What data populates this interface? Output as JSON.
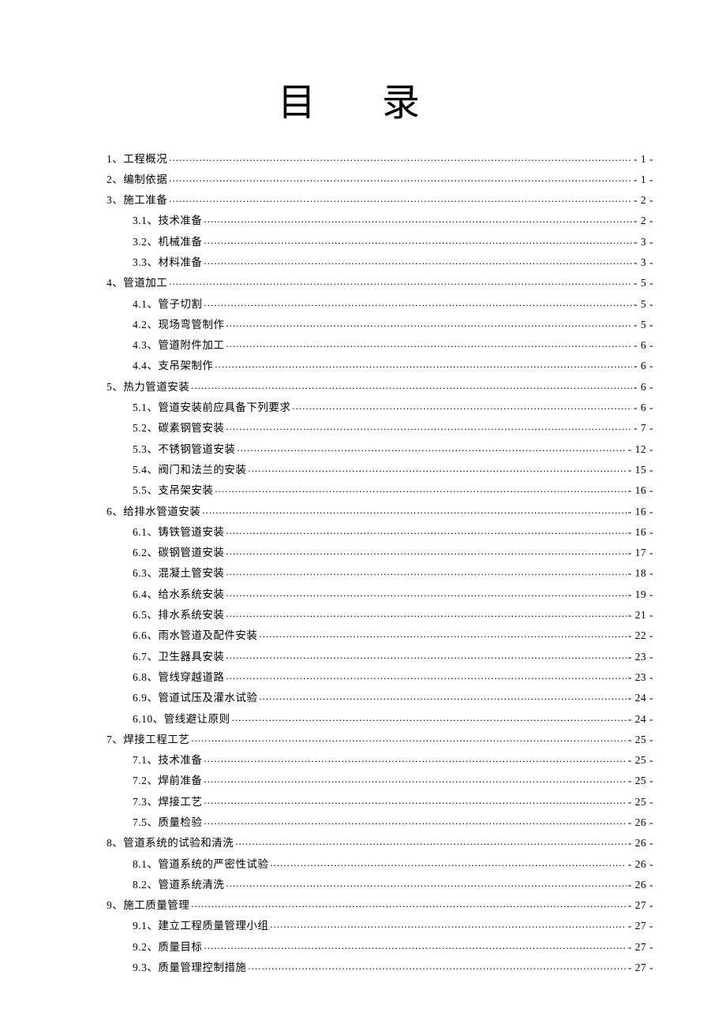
{
  "title": "目  录",
  "toc": [
    {
      "level": 1,
      "label": "1、工程概况",
      "page": "- 1 -"
    },
    {
      "level": 1,
      "label": "2、编制依据",
      "page": "- 1 -"
    },
    {
      "level": 1,
      "label": "3、施工准备",
      "page": "- 2 -"
    },
    {
      "level": 2,
      "label": "3.1、技术准备",
      "page": "- 2 -"
    },
    {
      "level": 2,
      "label": "3.2、机械准备",
      "page": "- 3 -"
    },
    {
      "level": 2,
      "label": "3.3、材料准备",
      "page": "- 3 -"
    },
    {
      "level": 1,
      "label": "4、管道加工",
      "page": "- 5 -"
    },
    {
      "level": 2,
      "label": "4.1、管子切割",
      "page": "- 5 -"
    },
    {
      "level": 2,
      "label": "4.2、现场弯管制作",
      "page": "- 5 -"
    },
    {
      "level": 2,
      "label": "4.3、管道附件加工",
      "page": "- 6 -"
    },
    {
      "level": 2,
      "label": "4.4、支吊架制作",
      "page": "- 6 -"
    },
    {
      "level": 1,
      "label": "5、热力管道安装",
      "page": "- 6 -"
    },
    {
      "level": 2,
      "label": "5.1、管道安装前应具备下列要求",
      "page": "- 6 -"
    },
    {
      "level": 2,
      "label": "5.2、碳素钢管安装",
      "page": "- 7 -"
    },
    {
      "level": 2,
      "label": "5.3、不锈钢管道安装",
      "page": "- 12 -"
    },
    {
      "level": 2,
      "label": "5.4、阀门和法兰的安装",
      "page": "- 15 -"
    },
    {
      "level": 2,
      "label": "5.5、支吊架安装",
      "page": "- 16 -"
    },
    {
      "level": 1,
      "label": "6、给排水管道安装",
      "page": "- 16 -"
    },
    {
      "level": 2,
      "label": "6.1、铸铁管道安装",
      "page": "- 16 -"
    },
    {
      "level": 2,
      "label": "6.2、碳钢管道安装",
      "page": "- 17 -"
    },
    {
      "level": 2,
      "label": "6.3、混凝土管安装",
      "page": "- 18 -"
    },
    {
      "level": 2,
      "label": "6.4、给水系统安装",
      "page": "- 19 -"
    },
    {
      "level": 2,
      "label": "6.5、排水系统安装",
      "page": "- 21 -"
    },
    {
      "level": 2,
      "label": "6.6、雨水管道及配件安装",
      "page": "- 22 -"
    },
    {
      "level": 2,
      "label": "6.7、卫生器具安装",
      "page": "- 23 -"
    },
    {
      "level": 2,
      "label": "6.8、管线穿越道路",
      "page": "- 23 -"
    },
    {
      "level": 2,
      "label": "6.9、管道试压及灌水试验",
      "page": "- 24 -"
    },
    {
      "level": 2,
      "label": "6.10、管线避让原则",
      "page": "- 24 -"
    },
    {
      "level": 1,
      "label": "7、焊接工程工艺",
      "page": "- 25 -"
    },
    {
      "level": 2,
      "label": "7.1、技术准备",
      "page": "- 25 -"
    },
    {
      "level": 2,
      "label": "7.2、焊前准备",
      "page": "- 25 -"
    },
    {
      "level": 2,
      "label": "7.3、焊接工艺",
      "page": "- 25 -"
    },
    {
      "level": 2,
      "label": "7.5、质量检验",
      "page": "- 26 -"
    },
    {
      "level": 1,
      "label": "8、管道系统的试验和清洗",
      "page": "- 26 -"
    },
    {
      "level": 2,
      "label": "8.1、管道系统的严密性试验",
      "page": "- 26 -"
    },
    {
      "level": 2,
      "label": "8.2、管道系统清洗",
      "page": "- 26 -"
    },
    {
      "level": 1,
      "label": "9、施工质量管理",
      "page": "- 27 -"
    },
    {
      "level": 2,
      "label": "9.1、建立工程质量管理小组",
      "page": "- 27 -"
    },
    {
      "level": 2,
      "label": "9.2、质量目标",
      "page": "- 27 -"
    },
    {
      "level": 2,
      "label": "9.3、质量管理控制措施",
      "page": "- 27 -"
    }
  ]
}
